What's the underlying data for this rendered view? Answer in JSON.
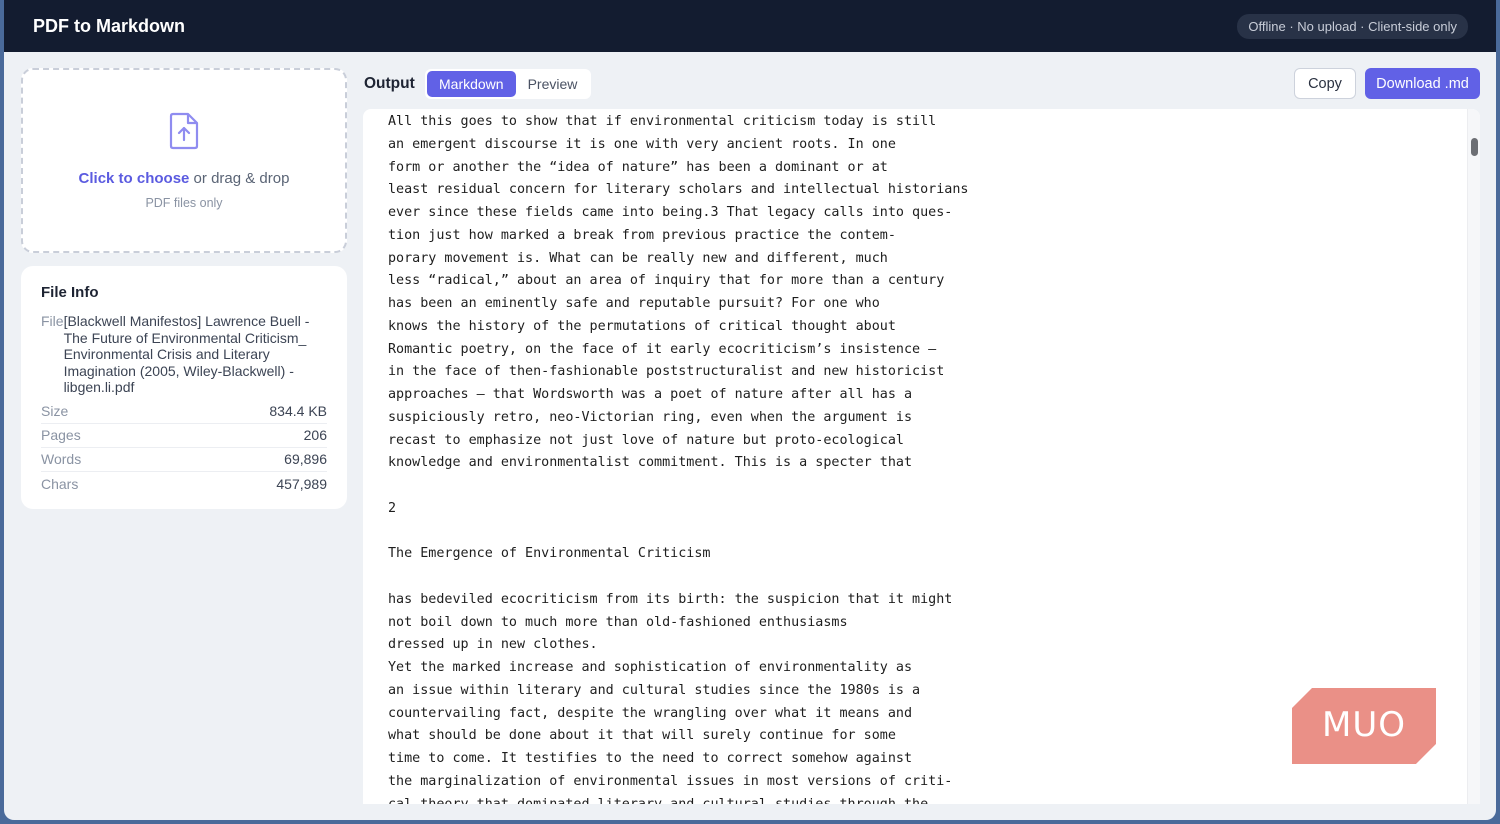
{
  "app": {
    "title": "PDF to Markdown",
    "status": "Offline · No upload · Client-side only"
  },
  "dropzone": {
    "icon": "file-upload-icon",
    "link_text": "Click to choose",
    "rest_text": " or drag & drop",
    "subtext": "PDF files only"
  },
  "file_info": {
    "title": "File Info",
    "file_label": "File",
    "file_name": "[Blackwell Manifestos] Lawrence Buell - The Future of Environmental Criticism_ Environmental Crisis and Literary Imagination (2005, Wiley-Blackwell) - libgen.li.pdf",
    "rows": [
      {
        "label": "Size",
        "value": "834.4 KB"
      },
      {
        "label": "Pages",
        "value": "206"
      },
      {
        "label": "Words",
        "value": "69,896"
      },
      {
        "label": "Chars",
        "value": "457,989"
      }
    ]
  },
  "output": {
    "label": "Output",
    "tabs": [
      "Markdown",
      "Preview"
    ],
    "active_tab": "Markdown",
    "copy_label": "Copy",
    "download_label": "Download .md",
    "lines": [
      "All this goes to show that if environmental criticism today is still",
      "an emergent discourse it is one with very ancient roots. In one",
      "form or another the “idea of nature” has been a dominant or at",
      "least residual concern for literary scholars and intellectual historians",
      "ever since these fields came into being.3 That legacy calls into ques-",
      "tion just how marked a break from previous practice the contem-",
      "porary movement is. What can be really new and different, much",
      "less “radical,” about an area of inquiry that for more than a century",
      "has been an eminently safe and reputable pursuit? For one who",
      "knows the history of the permutations of critical thought about",
      "Romantic poetry, on the face of it early ecocriticism’s insistence –",
      "in the face of then-fashionable poststructuralist and new historicist",
      "approaches – that Wordsworth was a poet of nature after all has a",
      "suspiciously retro, neo-Victorian ring, even when the argument is",
      "recast to emphasize not just love of nature but proto-ecological",
      "knowledge and environmentalist commitment. This is a specter that",
      "",
      "2",
      "",
      "The Emergence of Environmental Criticism",
      "",
      "has bedeviled ecocriticism from its birth: the suspicion that it might",
      "not boil down to much more than old-fashioned enthusiasms",
      "dressed up in new clothes.",
      "Yet the marked increase and sophistication of environmentality as",
      "an issue within literary and cultural studies since the 1980s is a",
      "countervailing fact, despite the wrangling over what it means and",
      "what should be done about it that will surely continue for some",
      "time to come. It testifies to the need to correct somehow against",
      "the marginalization of environmental issues in most versions of criti-",
      "cal theory that dominated literary and cultural studies through the"
    ]
  },
  "watermark": {
    "text": "MUO",
    "color": "#e8877d"
  }
}
